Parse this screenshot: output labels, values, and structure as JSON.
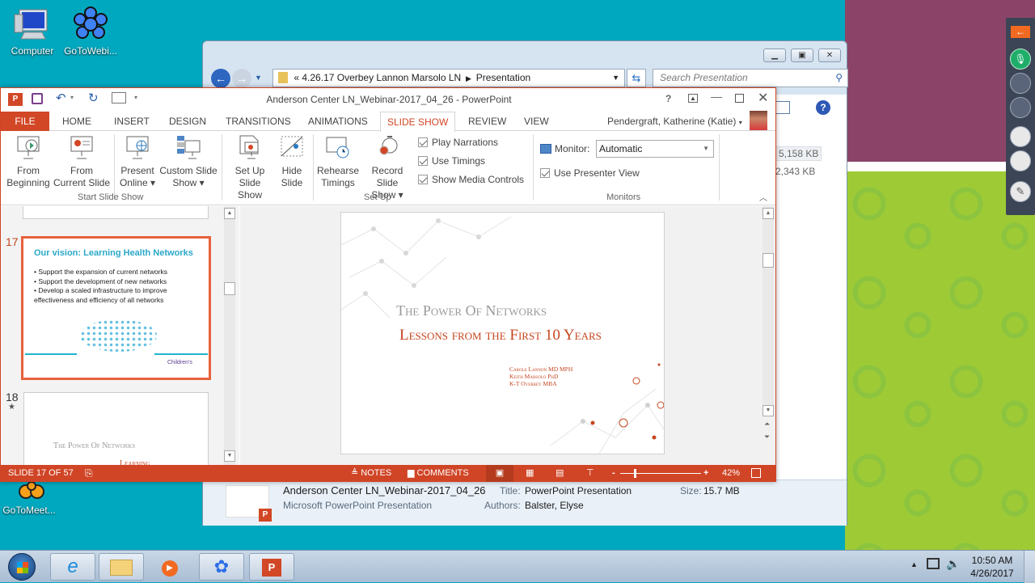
{
  "desktop": {
    "icons": [
      {
        "label": "Computer",
        "icon": "computer-icon"
      },
      {
        "label": "GoToWebi...",
        "icon": "gotowebinar-icon"
      },
      {
        "label": "GoToMeet...",
        "icon": "gotomeeting-icon"
      }
    ]
  },
  "explorer": {
    "breadcrumb_prefix": "«",
    "breadcrumb": [
      "4.26.17 Overbey Lannon Marsolo LN",
      "Presentation"
    ],
    "search_placeholder": "Search Presentation",
    "sizes": [
      "5,158 KB",
      "2,343 KB"
    ],
    "details": {
      "filename": "Anderson Center LN_Webinar-2017_04_26",
      "filetype": "Microsoft PowerPoint Presentation",
      "title_label": "Title:",
      "title_value": "PowerPoint Presentation",
      "authors_label": "Authors:",
      "authors_value": "Balster, Elyse",
      "size_label": "Size:",
      "size_value": "15.7 MB"
    }
  },
  "powerpoint": {
    "window_title": "Anderson Center LN_Webinar-2017_04_26 - PowerPoint",
    "help": "?",
    "user": "Pendergraft, Katherine (Katie)",
    "tabs": [
      "FILE",
      "HOME",
      "INSERT",
      "DESIGN",
      "TRANSITIONS",
      "ANIMATIONS",
      "SLIDE SHOW",
      "REVIEW",
      "VIEW"
    ],
    "active_tab": "SLIDE SHOW",
    "ribbon": {
      "start_group": "Start Slide Show",
      "from_beginning": [
        "From",
        "Beginning"
      ],
      "from_current": [
        "From",
        "Current Slide"
      ],
      "present_online": [
        "Present",
        "Online ▾"
      ],
      "custom_show": [
        "Custom Slide",
        "Show ▾"
      ],
      "setup_group": "Set Up",
      "setup_show": [
        "Set Up",
        "Slide Show"
      ],
      "hide_slide": [
        "Hide",
        "Slide"
      ],
      "rehearse": [
        "Rehearse",
        "Timings"
      ],
      "record": [
        "Record Slide",
        "Show ▾"
      ],
      "play_narrations": "Play Narrations",
      "use_timings": "Use Timings",
      "show_media_controls": "Show Media Controls",
      "monitors_group": "Monitors",
      "monitor_label": "Monitor:",
      "monitor_value": "Automatic",
      "use_presenter_view": "Use Presenter View"
    },
    "thumbnails": [
      {
        "number": "17",
        "title": "Our vision: Learning Health Networks",
        "bullets": [
          "Support the expansion of current networks",
          "Support the development of new networks",
          "Develop a scaled infrastructure to improve effectiveness and efficiency of all networks"
        ],
        "logo": "Children's"
      },
      {
        "number": "18",
        "star": "★",
        "title": "The Power Of Networks",
        "subtitle": "Learning"
      }
    ],
    "slide": {
      "title": "The Power Of Networks",
      "subtitle": "Lessons from the First 10 Years",
      "authors": [
        "Carole Lannon MD MPH",
        "Keith Marsolo PhD",
        "K-T Overbey MBA"
      ]
    },
    "status": {
      "slide_counter": "SLIDE 17 OF 57",
      "notes": "NOTES",
      "comments": "COMMENTS",
      "zoom_percent": "42%",
      "zoom_value": 42
    },
    "colors": {
      "accent": "#d24726",
      "teal": "#2aa9c8"
    }
  },
  "taskbar": {
    "apps": [
      "start",
      "internet-explorer",
      "windows-explorer",
      "media-player",
      "gotowebinar",
      "powerpoint"
    ],
    "time": "10:50 AM",
    "date": "4/26/2017"
  }
}
